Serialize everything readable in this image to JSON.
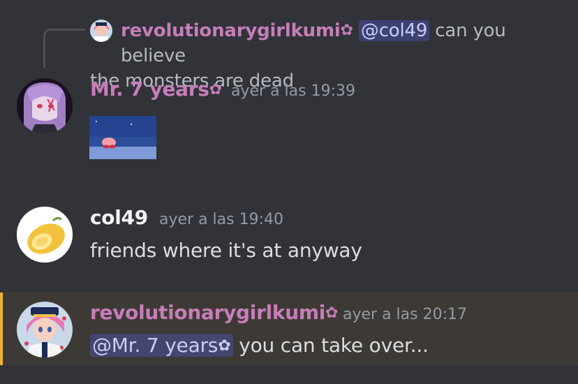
{
  "reply": {
    "author": "revolutionarygirlkumi",
    "author_suffix": "✿",
    "mention": "@col49",
    "text_line1": " can you believe",
    "text_line2": "the monsters are dead"
  },
  "messages": [
    {
      "author": "Mr. 7 years",
      "author_suffix": "✿",
      "timestamp": "ayer a las 19:39",
      "name_color": "#c77dba"
    },
    {
      "author": "col49",
      "timestamp": "ayer a las 19:40",
      "text": "friends where it's at anyway",
      "name_color": "#f2f3f5"
    },
    {
      "author": "revolutionarygirlkumi",
      "author_suffix": "✿",
      "timestamp": "ayer a las 20:17",
      "mention": "@Mr. 7 years",
      "mention_suffix": "✿",
      "text": " you can take over...",
      "name_color": "#c77dba",
      "highlight_color": "#f0b232"
    }
  ]
}
